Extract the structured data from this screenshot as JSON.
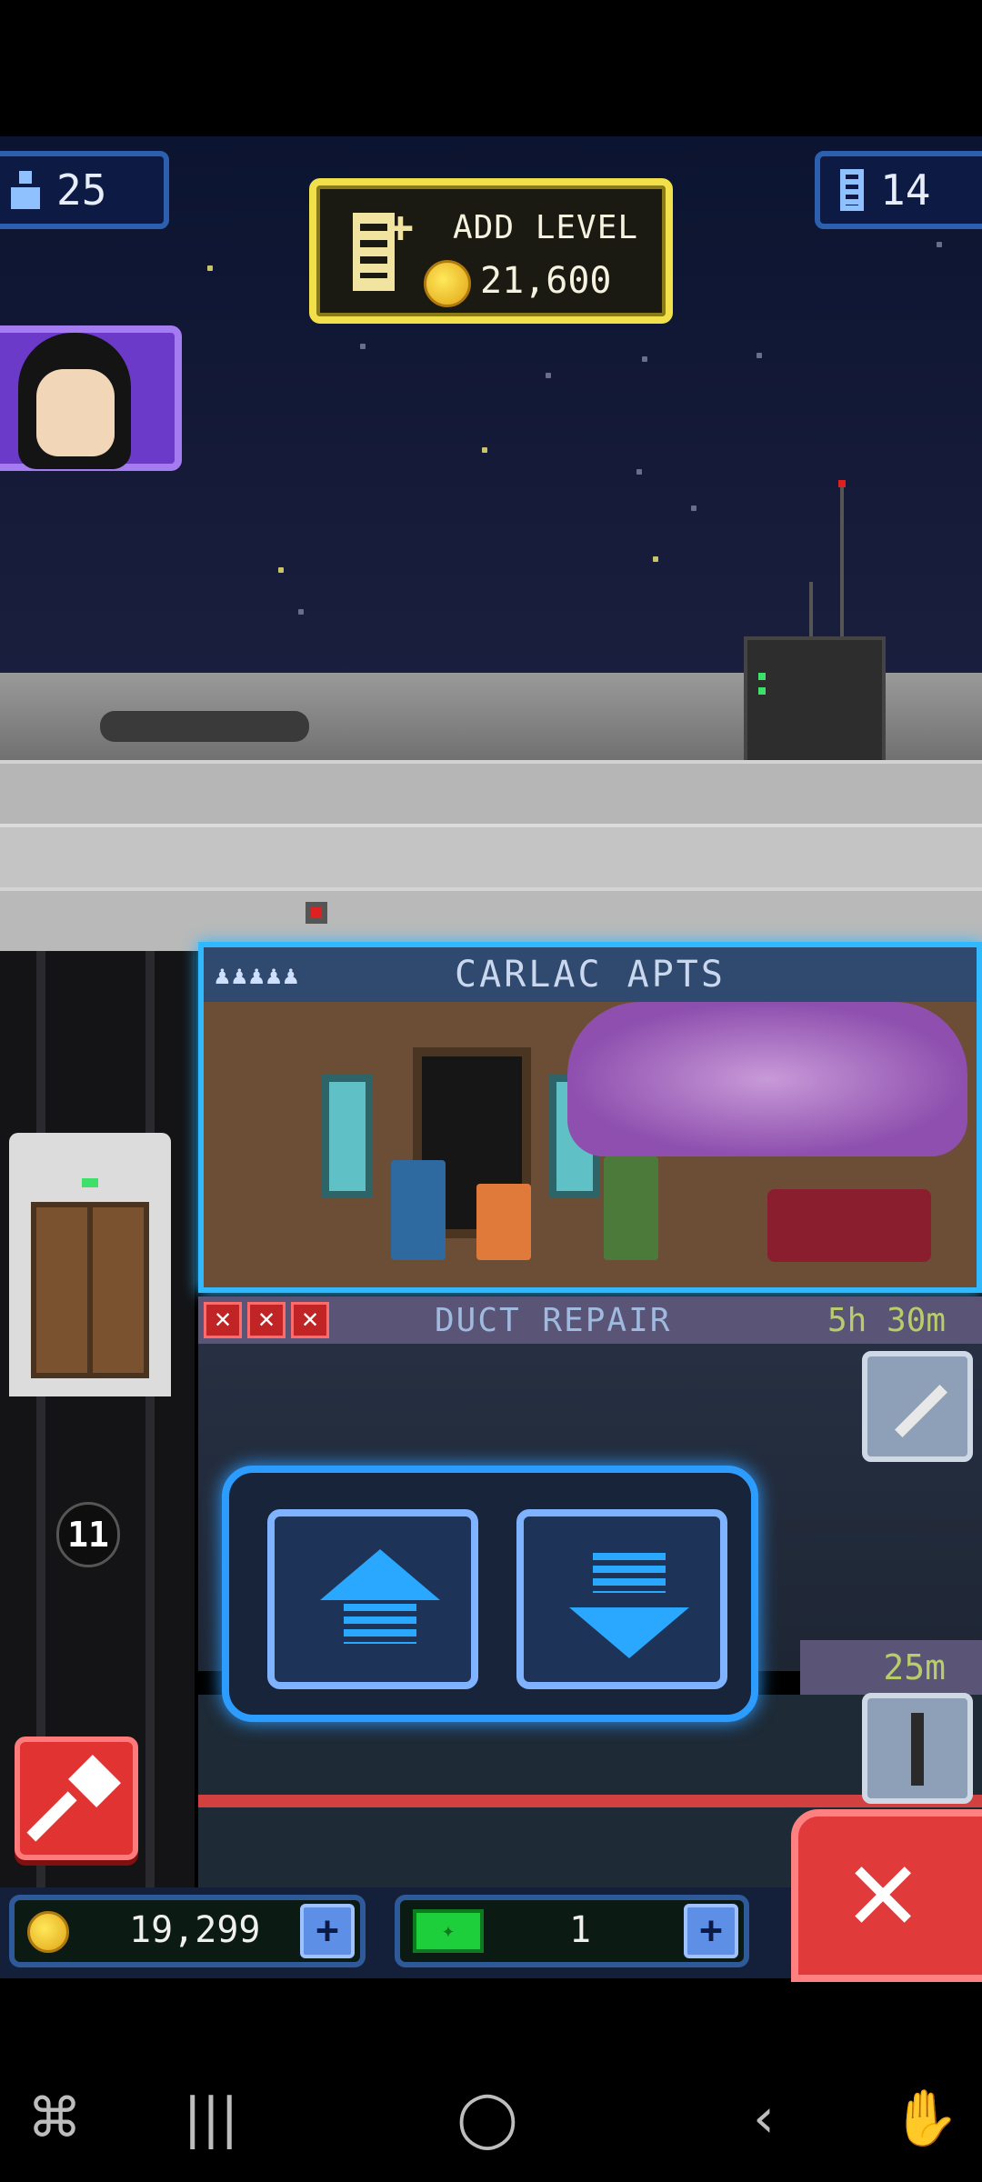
{
  "hud": {
    "population": "25",
    "floors": "14",
    "add_level": {
      "label": "ADD LEVEL",
      "cost": "21,600"
    }
  },
  "apartment": {
    "name": "CARLAC APTS",
    "occupancy_icons": "♟♟♟♟♟"
  },
  "duct_repair": {
    "fail_marks": [
      "✕",
      "✕",
      "✕"
    ],
    "name": "DUCT REPAIR",
    "timer": "5h 30m"
  },
  "lower_timer": "25m",
  "elevator": {
    "floor": "11"
  },
  "bottom_bar": {
    "coins": "19,299",
    "bux": "1",
    "plus_label": "+"
  },
  "close_label": "✕",
  "nav": {
    "games": "⌘",
    "recents": "|||",
    "home": "◯",
    "back": "‹",
    "assist": "✋"
  },
  "colors": {
    "accent_blue": "#31b9ff",
    "gold": "#f1e04a",
    "danger": "#e03a3a",
    "avatar_purple": "#6b3ac9"
  }
}
